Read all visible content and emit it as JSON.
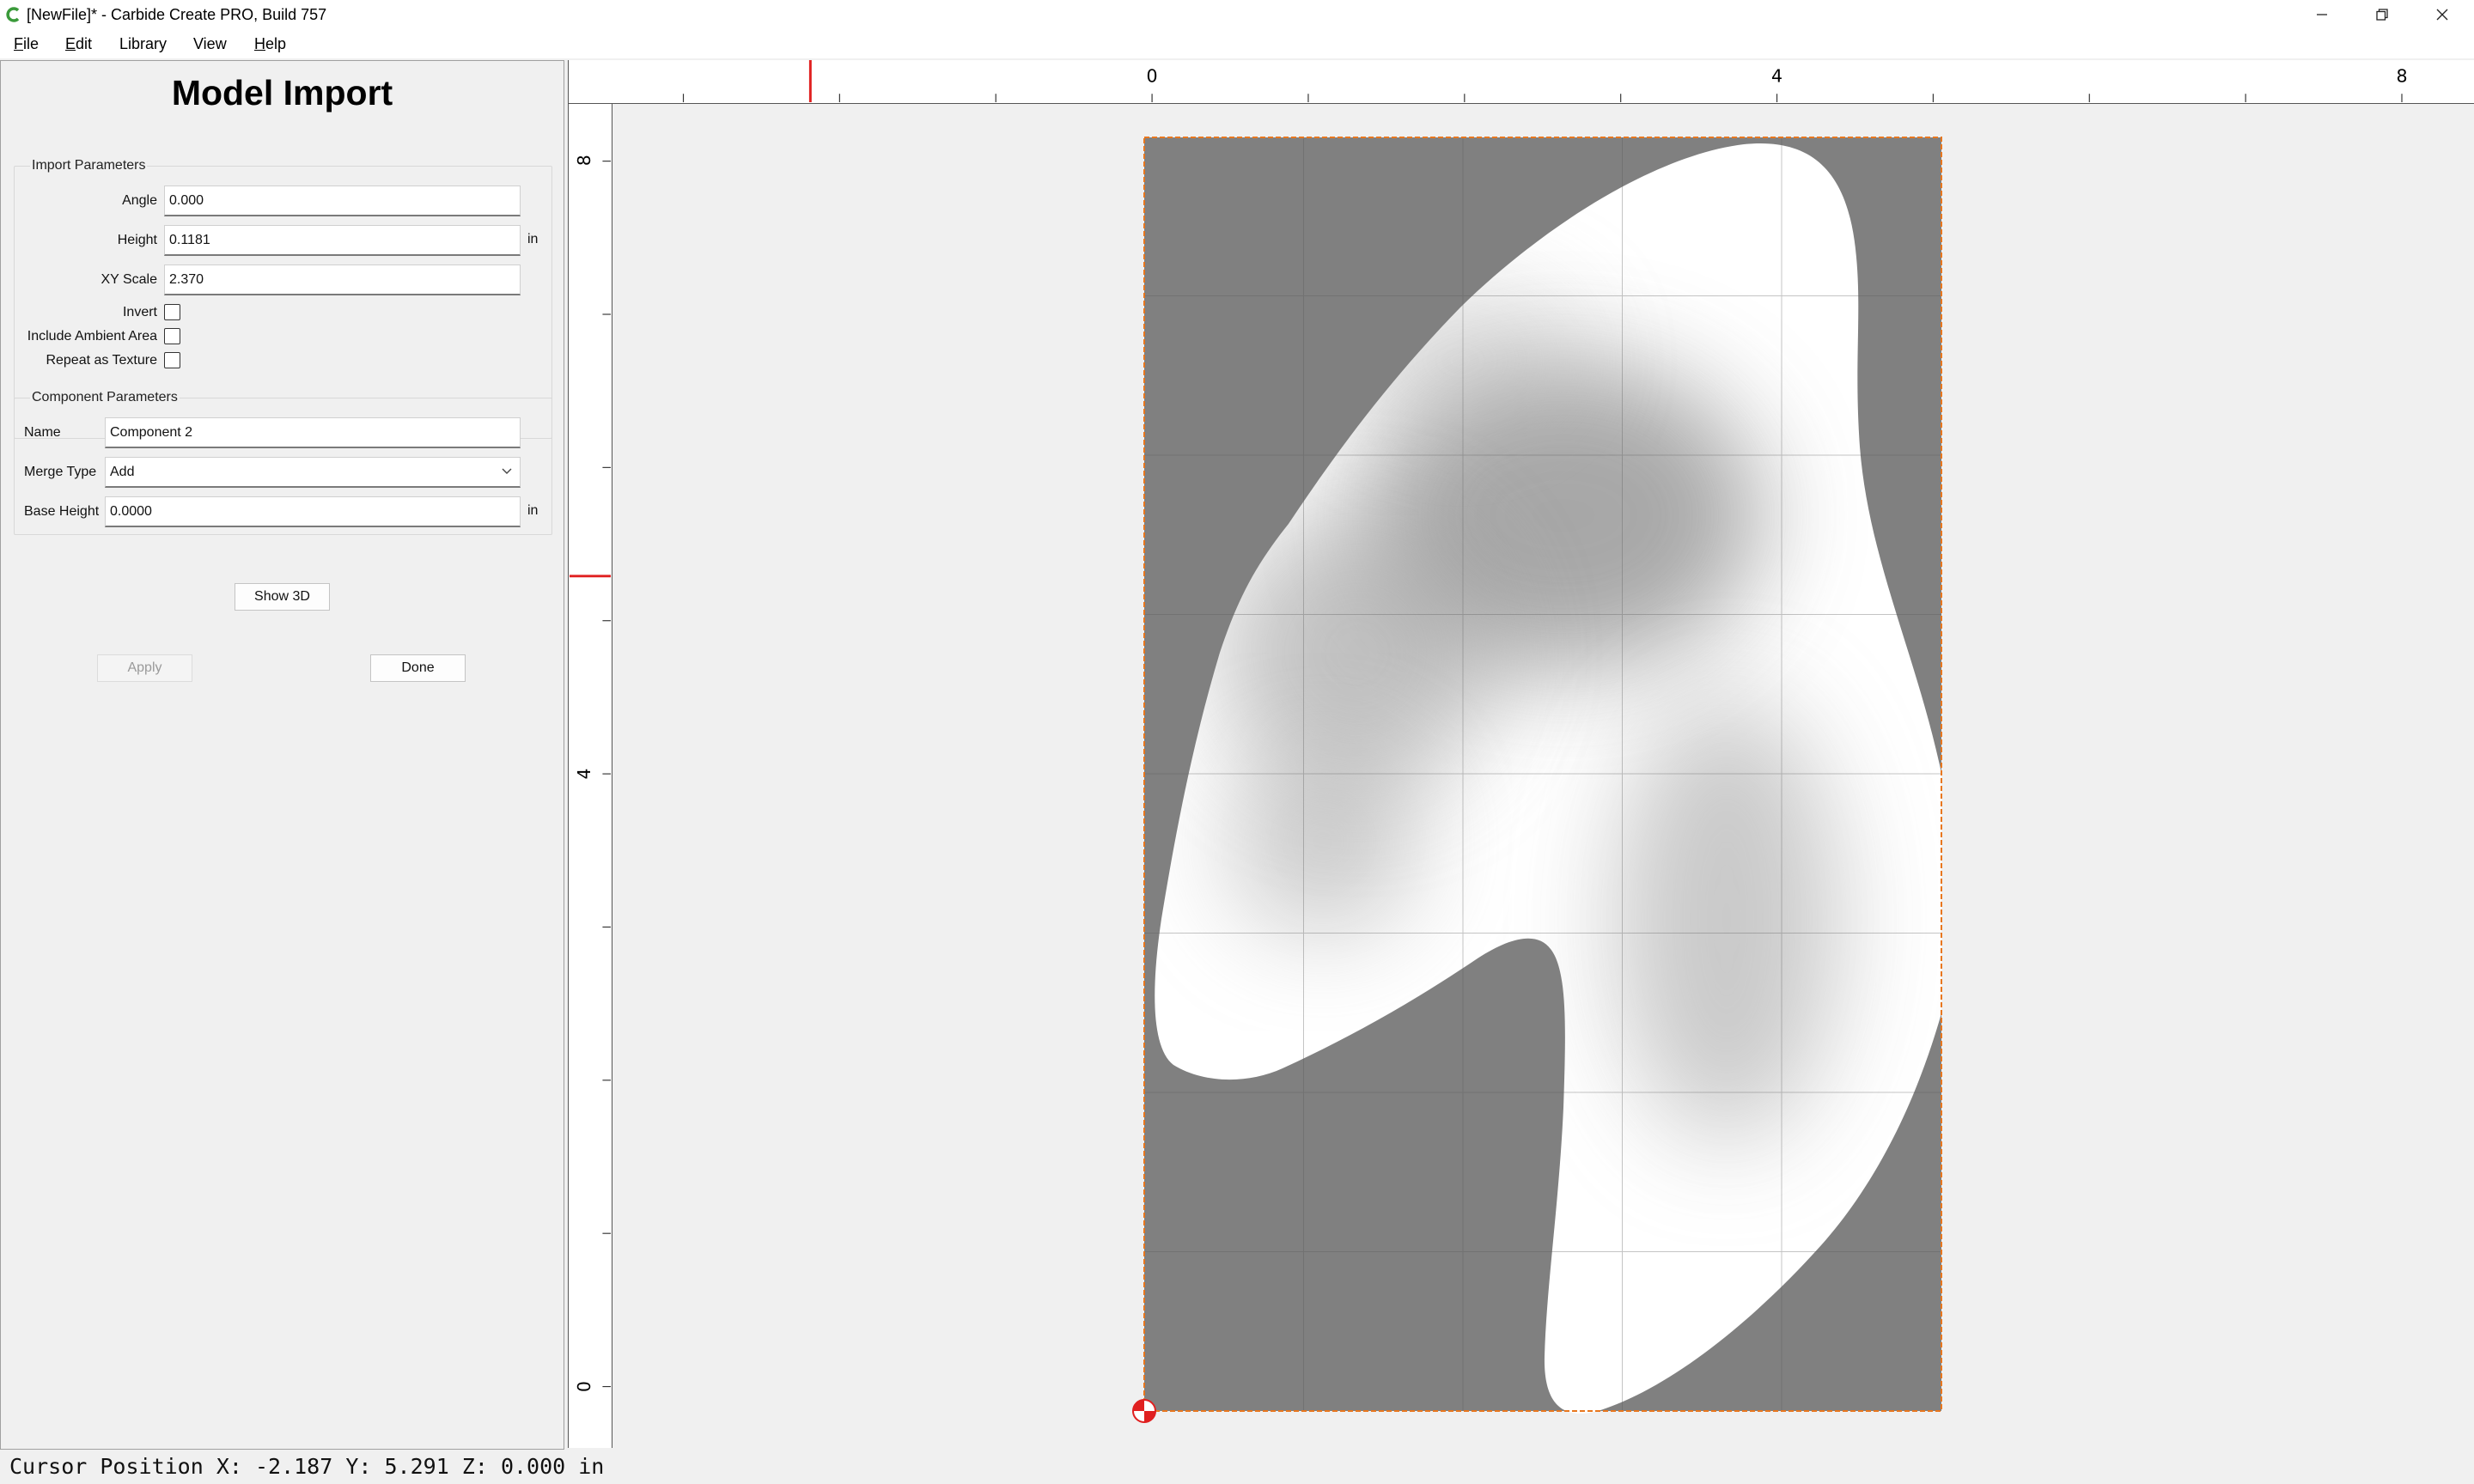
{
  "window": {
    "title": "[NewFile]* - Carbide Create PRO, Build 757",
    "app_icon": "carbide-c-icon",
    "controls": [
      "minimize-icon",
      "restore-icon",
      "close-icon"
    ]
  },
  "menu": {
    "items": [
      {
        "key": "F",
        "rest": "ile"
      },
      {
        "key": "E",
        "rest": "dit"
      },
      {
        "key": "",
        "rest": "Library"
      },
      {
        "key": "",
        "rest": "View"
      },
      {
        "key": "H",
        "rest": "elp"
      }
    ]
  },
  "panel": {
    "title": "Model Import",
    "import_group": {
      "title": "Import Parameters",
      "angle_label": "Angle",
      "angle_value": "0.000",
      "height_label": "Height",
      "height_value": "0.1181",
      "height_unit": "in",
      "xyscale_label": "XY Scale",
      "xyscale_value": "2.370",
      "invert_label": "Invert",
      "invert_checked": false,
      "ambient_label": "Include Ambient Area",
      "ambient_checked": false,
      "texture_label": "Repeat as Texture",
      "texture_checked": false
    },
    "component_group": {
      "title": "Component Parameters",
      "name_label": "Name",
      "name_value": "Component 2",
      "merge_label": "Merge Type",
      "merge_value": "Add",
      "base_label": "Base Height",
      "base_value": "0.0000",
      "base_unit": "in"
    },
    "show3d_label": "Show 3D",
    "apply_label": "Apply",
    "done_label": "Done"
  },
  "canvas": {
    "ruler_top_labels": [
      "0",
      "4",
      "8"
    ],
    "ruler_left_labels": [
      "8",
      "4",
      "0"
    ],
    "cursor_marker_x_in": -2.187,
    "cursor_marker_y_in": 5.291,
    "colors": {
      "background": "#808080",
      "selection_outline": "#e8771e",
      "cursor_marker": "#e02020"
    }
  },
  "status": {
    "cursor_position": "Cursor Position X: -2.187 Y: 5.291 Z: 0.000 in"
  }
}
